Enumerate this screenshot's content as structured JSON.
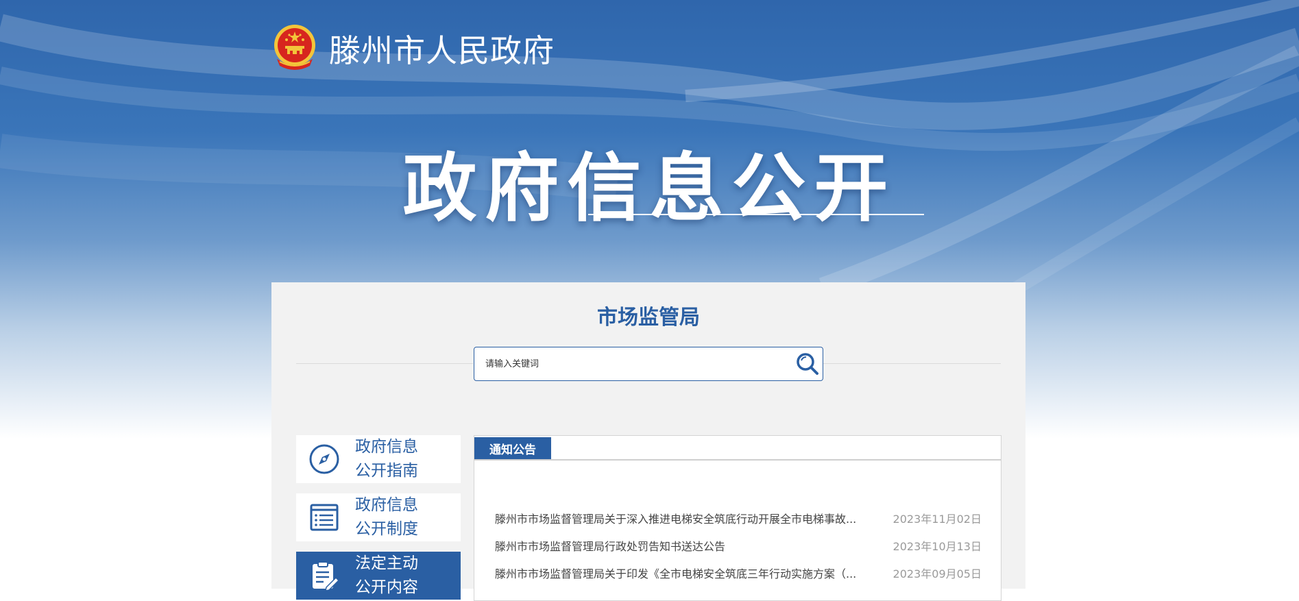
{
  "header": {
    "site_title": "滕州市人民政府",
    "hero_title": "政府信息公开"
  },
  "department": {
    "title": "市场监管局"
  },
  "search": {
    "placeholder": "请输入关键词"
  },
  "sidebar": {
    "items": [
      {
        "line1": "政府信息",
        "line2": "公开指南",
        "icon": "compass-icon",
        "active": false
      },
      {
        "line1": "政府信息",
        "line2": "公开制度",
        "icon": "list-icon",
        "active": false
      },
      {
        "line1": "法定主动",
        "line2": "公开内容",
        "icon": "document-edit-icon",
        "active": true
      }
    ]
  },
  "notices": {
    "tab_label": "通知公告",
    "items": [
      {
        "title": "滕州市市场监督管理局关于深入推进电梯安全筑底行动开展全市电梯事故...",
        "date": "2023年11月02日"
      },
      {
        "title": "滕州市市场监督管理局行政处罚告知书送达公告",
        "date": "2023年10月13日"
      },
      {
        "title": "滕州市市场监督管理局关于印发《全市电梯安全筑底三年行动实施方案（...",
        "date": "2023年09月05日"
      }
    ]
  },
  "colors": {
    "brand_blue": "#2a5fa3",
    "banner_top": "#2f66ac",
    "panel_bg": "#f2f2f2",
    "emblem_red": "#d7261e",
    "emblem_gold": "#f3c53a"
  }
}
